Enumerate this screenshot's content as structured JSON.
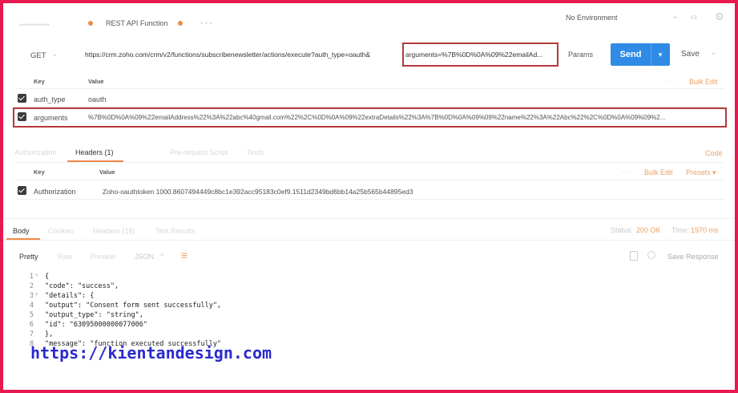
{
  "tabbar": {
    "ghost_tab": "••••••••••••",
    "active_tab": "REST API Function",
    "more": "• • •",
    "environment": "No Environment",
    "env_chevron": "⌄",
    "eye": "‹›",
    "gear": "⚙"
  },
  "request": {
    "method": "GET",
    "url": "https://crm.zoho.com/crm/v2/functions/subscribenewsletter/actions/execute?auth_type=oauth&",
    "url_highlight": "arguments=%7B%0D%0A%09%22emailAd...",
    "params": "Params",
    "send": "Send",
    "send_caret": "▾",
    "save": "Save"
  },
  "params_table": {
    "key_header": "Key",
    "value_header": "Value",
    "more": "· · ·",
    "bulk_edit": "Bulk Edit",
    "rows": [
      {
        "key": "auth_type",
        "value": "oauth"
      },
      {
        "key": "arguments",
        "value": "%7B%0D%0A%09%22emailAddress%22%3A%22abc%40gmail.com%22%2C%0D%0A%09%22extraDetails%22%3A%7B%0D%0A%09%09%22name%22%3A%22Abc%22%2C%0D%0A%09%09%2..."
      }
    ]
  },
  "req_tabs": {
    "authorization": "Authorization",
    "headers": "Headers (1)",
    "prerequest": "Pre-request Script",
    "tests": "Tests",
    "code": "Code"
  },
  "headers_table": {
    "key_header": "Key",
    "value_header": "Value",
    "more": "· · ·",
    "bulk_edit": "Bulk Edit",
    "presets": "Presets ▾",
    "rows": [
      {
        "key": "Authorization",
        "value": "Zoho-oauthtoken 1000.8607494449c8bc1e392acc95183c0ef9.1511d2349bd6bb14a25b565b44895ed3"
      }
    ]
  },
  "resp_tabs": {
    "body": "Body",
    "cookies": "Cookies",
    "headers": "Headers (18)",
    "test_results": "Test Results",
    "status_label": "Status:",
    "status_value": "200 OK",
    "time_label": "Time:",
    "time_value": "1970 ms"
  },
  "resp_toolbar": {
    "pretty": "Pretty",
    "raw": "Raw",
    "preview": "Preview",
    "format": "JSON",
    "format_caret": "⌄",
    "wrap": "≡",
    "save_response": "Save Response"
  },
  "response_lines": [
    {
      "n": "1",
      "fold": "▾",
      "text": "{"
    },
    {
      "n": "2",
      "fold": "",
      "text": "    \"code\": \"success\","
    },
    {
      "n": "3",
      "fold": "▾",
      "text": "    \"details\": {"
    },
    {
      "n": "4",
      "fold": "",
      "text": "        \"output\": \"Consent form sent successfully\","
    },
    {
      "n": "5",
      "fold": "",
      "text": "        \"output_type\": \"string\","
    },
    {
      "n": "6",
      "fold": "",
      "text": "        \"id\": \"63095000000077006\""
    },
    {
      "n": "7",
      "fold": "",
      "text": "    },"
    },
    {
      "n": "8",
      "fold": "",
      "text": "    \"message\": \"function executed successfully\""
    }
  ],
  "watermark": "https://kientandesign.com",
  "colors": {
    "accent": "#f08a4b",
    "send": "#2f8be6",
    "border": "#e8194f",
    "highlight": "#b33a3a"
  }
}
